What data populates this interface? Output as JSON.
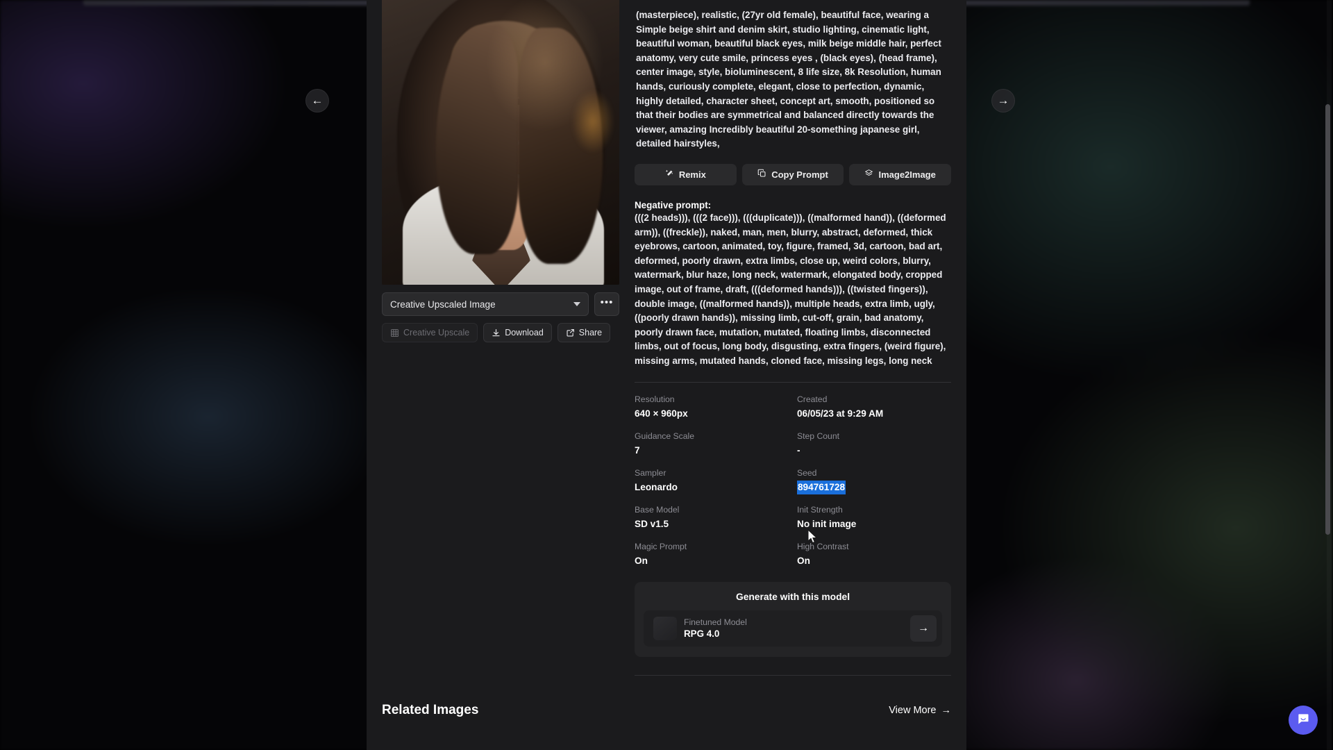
{
  "image_panel": {
    "prev_label": "←",
    "next_label": "→",
    "variant_select_value": "Creative Upscaled Image",
    "more_button_label": "•••",
    "buttons": [
      {
        "label": "Creative Upscale",
        "icon": "upscale-icon",
        "disabled": true
      },
      {
        "label": "Download",
        "icon": "download-icon",
        "disabled": false
      },
      {
        "label": "Share",
        "icon": "share-icon",
        "disabled": false
      }
    ]
  },
  "details": {
    "prompt": "(masterpiece), realistic, (27yr old female), beautiful face, wearing a Simple beige shirt and denim skirt, studio lighting, cinematic light, beautiful woman, beautiful black eyes, milk beige middle hair, perfect anatomy, very cute smile, princess eyes , (black eyes), (head frame), center image, style, bioluminescent, 8 life size, 8k Resolution, human hands, curiously complete, elegant, close to perfection, dynamic, highly detailed, character sheet, concept art, smooth, positioned so that their bodies are symmetrical and balanced directly towards the viewer, amazing Incredibly beautiful 20-something japanese girl, detailed hairstyles,",
    "prompt_actions": [
      {
        "label": "Remix",
        "icon": "wand-icon"
      },
      {
        "label": "Copy Prompt",
        "icon": "copy-icon"
      },
      {
        "label": "Image2Image",
        "icon": "layers-icon"
      }
    ],
    "negative_prompt_title": "Negative prompt:",
    "negative_prompt": "(((2 heads))), (((2 face))), (((duplicate))), ((malformed hand)), ((deformed arm)), ((freckle)), naked, man, men, blurry, abstract, deformed, thick eyebrows, cartoon, animated, toy, figure, framed, 3d, cartoon, bad art, deformed, poorly drawn, extra limbs, close up, weird colors, blurry, watermark, blur haze, long neck, watermark, elongated body, cropped image, out of frame, draft, (((deformed hands))), ((twisted fingers)), double image, ((malformed hands)), multiple heads, extra limb, ugly, ((poorly drawn hands)), missing limb, cut-off, grain, bad anatomy, poorly drawn face, mutation, mutated, floating limbs, disconnected limbs, out of focus, long body, disgusting, extra fingers, (weird figure), missing arms, mutated hands, cloned face, missing legs, long neck"
  },
  "metadata": [
    {
      "label": "Resolution",
      "value": "640 × 960px",
      "selected": false
    },
    {
      "label": "Created",
      "value": "06/05/23 at 9:29 AM",
      "selected": false
    },
    {
      "label": "Guidance Scale",
      "value": "7",
      "selected": false
    },
    {
      "label": "Step Count",
      "value": "-",
      "selected": false
    },
    {
      "label": "Sampler",
      "value": "Leonardo",
      "selected": false
    },
    {
      "label": "Seed",
      "value": "894761728",
      "selected": true
    },
    {
      "label": "Base Model",
      "value": "SD v1.5",
      "selected": false
    },
    {
      "label": "Init Strength",
      "value": "No init image",
      "selected": false
    },
    {
      "label": "Magic Prompt",
      "value": "On",
      "selected": false
    },
    {
      "label": "High Contrast",
      "value": "On",
      "selected": false
    }
  ],
  "generate_card": {
    "title": "Generate with this model",
    "model_label": "Finetuned Model",
    "model_name": "RPG 4.0",
    "go_label": "→"
  },
  "related": {
    "title": "Related Images",
    "view_more_label": "View More",
    "view_more_arrow": "→"
  },
  "chat": {
    "icon": "chat-bubble-icon"
  },
  "colors": {
    "modal_bg": "#1b1b1d",
    "accent_selection": "#1a6fdb",
    "chat_accent": "#5b5bf0",
    "label_gray": "#8d8d94"
  }
}
